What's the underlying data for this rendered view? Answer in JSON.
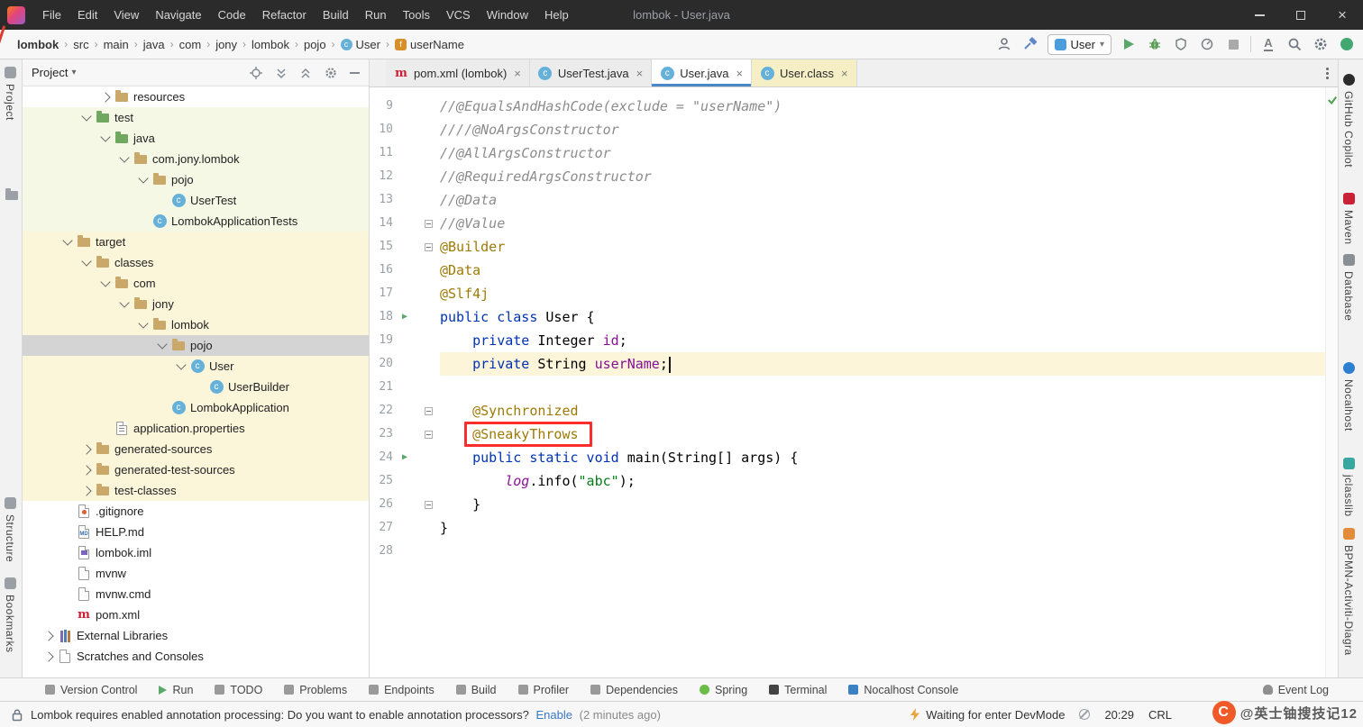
{
  "icons": {
    "chevron_down": "▾",
    "breadcrumb_separator": "›",
    "close_tab": "×",
    "run_glyph": "▶",
    "class_letter": "c",
    "field_letter": "f",
    "maven_letter": "m"
  },
  "colors": {
    "keyword": "#0033B3",
    "annotation": "#9E7A06",
    "string": "#067D17",
    "field": "#871094",
    "comment": "#8C8C8C",
    "red_box": "#FB2D2D",
    "run_green": "#59A869",
    "selection_gray": "#D4D4D4",
    "excluded_yellow": "#FBF5DA",
    "active_tab_underline": "#4A88C7"
  },
  "title_bar": {
    "title": "lombok - User.java",
    "menus": [
      "File",
      "Edit",
      "View",
      "Navigate",
      "Code",
      "Refactor",
      "Build",
      "Run",
      "Tools",
      "VCS",
      "Window",
      "Help"
    ]
  },
  "breadcrumb": {
    "items": [
      {
        "label": "lombok",
        "bold": true
      },
      {
        "label": "src"
      },
      {
        "label": "main"
      },
      {
        "label": "java"
      },
      {
        "label": "com"
      },
      {
        "label": "jony"
      },
      {
        "label": "lombok"
      },
      {
        "label": "pojo"
      },
      {
        "label": "User",
        "icon": "class"
      },
      {
        "label": "userName",
        "icon": "field"
      }
    ]
  },
  "toolbar": {
    "run_config": "User",
    "icons": [
      "profile-icon",
      "build-hammer-icon",
      "run-icon",
      "debug-icon",
      "coverage-icon",
      "profiler-icon",
      "stop-icon",
      "translate-icon",
      "search-icon",
      "settings-gear-icon",
      "plugin-icon"
    ]
  },
  "left_stripe": {
    "items": [
      "Project",
      "Structure",
      "Bookmarks"
    ]
  },
  "right_stripe": {
    "items": [
      "GitHub Copilot",
      "Maven",
      "Database",
      "Nocalhost",
      "jclasslib",
      "BPMN-Activiti-Diagra"
    ]
  },
  "project_panel": {
    "title": "Project",
    "tree": [
      {
        "label": "resources",
        "indent": 4,
        "chev": "c",
        "icon": "folder"
      },
      {
        "label": "test",
        "indent": 3,
        "chev": "e",
        "icon": "folder-green",
        "bg": "test"
      },
      {
        "label": "java",
        "indent": 4,
        "chev": "e",
        "icon": "folder-green",
        "bg": "test"
      },
      {
        "label": "com.jony.lombok",
        "indent": 5,
        "chev": "e",
        "icon": "package",
        "bg": "test"
      },
      {
        "label": "pojo",
        "indent": 6,
        "chev": "e",
        "icon": "package",
        "bg": "test"
      },
      {
        "label": "UserTest",
        "indent": 7,
        "icon": "class",
        "bg": "test"
      },
      {
        "label": "LombokApplicationTests",
        "indent": 6,
        "icon": "class",
        "bg": "test"
      },
      {
        "label": "target",
        "indent": 2,
        "chev": "e",
        "icon": "folder",
        "bg": "out"
      },
      {
        "label": "classes",
        "indent": 3,
        "chev": "e",
        "icon": "folder",
        "bg": "out"
      },
      {
        "label": "com",
        "indent": 4,
        "chev": "e",
        "icon": "package",
        "bg": "out"
      },
      {
        "label": "jony",
        "indent": 5,
        "chev": "e",
        "icon": "package",
        "bg": "out"
      },
      {
        "label": "lombok",
        "indent": 6,
        "chev": "e",
        "icon": "package",
        "bg": "out"
      },
      {
        "label": "pojo",
        "indent": 7,
        "chev": "e",
        "icon": "package",
        "bg": "out",
        "selected": true
      },
      {
        "label": "User",
        "indent": 8,
        "chev": "e",
        "icon": "class",
        "bg": "out"
      },
      {
        "label": "UserBuilder",
        "indent": 9,
        "icon": "class",
        "bg": "out"
      },
      {
        "label": "LombokApplication",
        "indent": 7,
        "icon": "class",
        "bg": "out"
      },
      {
        "label": "application.properties",
        "indent": 4,
        "icon": "props",
        "bg": "out"
      },
      {
        "label": "generated-sources",
        "indent": 3,
        "chev": "c",
        "icon": "folder",
        "bg": "out"
      },
      {
        "label": "generated-test-sources",
        "indent": 3,
        "chev": "c",
        "icon": "folder",
        "bg": "out"
      },
      {
        "label": "test-classes",
        "indent": 3,
        "chev": "c",
        "icon": "folder",
        "bg": "out"
      },
      {
        "label": ".gitignore",
        "indent": 2,
        "icon": "git"
      },
      {
        "label": "HELP.md",
        "indent": 2,
        "icon": "md"
      },
      {
        "label": "lombok.iml",
        "indent": 2,
        "icon": "iml"
      },
      {
        "label": "mvnw",
        "indent": 2,
        "icon": "script"
      },
      {
        "label": "mvnw.cmd",
        "indent": 2,
        "icon": "script"
      },
      {
        "label": "pom.xml",
        "indent": 2,
        "icon": "maven"
      },
      {
        "label": "External Libraries",
        "indent": 1,
        "chev": "c",
        "icon": "libs"
      },
      {
        "label": "Scratches and Consoles",
        "indent": 1,
        "chev": "c",
        "icon": "scratch"
      }
    ]
  },
  "editor": {
    "tabs": [
      {
        "label": "pom.xml (lombok)",
        "icon": "maven"
      },
      {
        "label": "UserTest.java",
        "icon": "class"
      },
      {
        "label": "User.java",
        "icon": "class",
        "active": true
      },
      {
        "label": "User.class",
        "icon": "class",
        "tint": true
      }
    ],
    "lines": [
      {
        "n": 9,
        "t": [
          [
            "c",
            "//@EqualsAndHashCode(exclude = \"userName\")"
          ]
        ]
      },
      {
        "n": 10,
        "t": [
          [
            "c",
            "////@NoArgsConstructor"
          ]
        ]
      },
      {
        "n": 11,
        "t": [
          [
            "c",
            "//@AllArgsConstructor"
          ]
        ]
      },
      {
        "n": 12,
        "t": [
          [
            "c",
            "//@RequiredArgsConstructor"
          ]
        ]
      },
      {
        "n": 13,
        "t": [
          [
            "c",
            "//@Data"
          ]
        ]
      },
      {
        "n": 14,
        "t": [
          [
            "c",
            "//@Value"
          ]
        ],
        "fold": true
      },
      {
        "n": 15,
        "t": [
          [
            "a",
            "@Builder"
          ]
        ],
        "fold": true
      },
      {
        "n": 16,
        "t": [
          [
            "a",
            "@Data"
          ]
        ]
      },
      {
        "n": 17,
        "t": [
          [
            "a",
            "@Slf4j"
          ]
        ]
      },
      {
        "n": 18,
        "t": [
          [
            "k",
            "public class"
          ],
          [
            "p",
            " User {"
          ]
        ],
        "run": true
      },
      {
        "n": 19,
        "t": [
          [
            "p",
            "    "
          ],
          [
            "k",
            "private"
          ],
          [
            "p",
            " Integer "
          ],
          [
            "f",
            "id"
          ],
          [
            "p",
            ";"
          ]
        ]
      },
      {
        "n": 20,
        "t": [
          [
            "p",
            "    "
          ],
          [
            "k",
            "private"
          ],
          [
            "p",
            " String "
          ],
          [
            "f",
            "userName"
          ],
          [
            "p",
            ";"
          ]
        ],
        "current": true,
        "caret": true
      },
      {
        "n": 21,
        "t": []
      },
      {
        "n": 22,
        "t": [
          [
            "p",
            "    "
          ],
          [
            "a",
            "@Synchronized"
          ]
        ],
        "fold": true
      },
      {
        "n": 23,
        "t": [
          [
            "p",
            "    "
          ],
          [
            "ab",
            "@SneakyThrows"
          ]
        ],
        "fold": true
      },
      {
        "n": 24,
        "t": [
          [
            "p",
            "    "
          ],
          [
            "k",
            "public static void"
          ],
          [
            "p",
            " main(String[] args) {"
          ]
        ],
        "run": true
      },
      {
        "n": 25,
        "t": [
          [
            "p",
            "        "
          ],
          [
            "fi",
            "log"
          ],
          [
            "p",
            ".info("
          ],
          [
            "s",
            "\"abc\""
          ],
          [
            "p",
            ");"
          ]
        ]
      },
      {
        "n": 26,
        "t": [
          [
            "p",
            "    }"
          ]
        ],
        "fold": true
      },
      {
        "n": 27,
        "t": [
          [
            "p",
            "}"
          ]
        ]
      },
      {
        "n": 28,
        "t": []
      }
    ]
  },
  "bottom_bar": {
    "left": [
      {
        "label": "Version Control",
        "icon": "gray"
      },
      {
        "label": "Run",
        "icon": "tri"
      },
      {
        "label": "TODO",
        "icon": "gray"
      },
      {
        "label": "Problems",
        "icon": "gray"
      },
      {
        "label": "Endpoints",
        "icon": "gray"
      },
      {
        "label": "Build",
        "icon": "gray"
      },
      {
        "label": "Profiler",
        "icon": "gray"
      },
      {
        "label": "Dependencies",
        "icon": "gray"
      },
      {
        "label": "Spring",
        "icon": "green-circle"
      },
      {
        "label": "Terminal",
        "icon": "dark"
      },
      {
        "label": "Nocalhost Console",
        "icon": "blue"
      }
    ],
    "right": [
      {
        "label": "Event Log",
        "icon": "bell"
      }
    ]
  },
  "status_bar": {
    "message": "Lombok requires enabled annotation processing: Do you want to enable annotation processors?",
    "link": "Enable",
    "suffix": "(2 minutes ago)",
    "devmode": "Waiting for enter DevMode",
    "time": "20:29",
    "encoding": "CRL",
    "watermark": "@英士铀搜技记12"
  }
}
